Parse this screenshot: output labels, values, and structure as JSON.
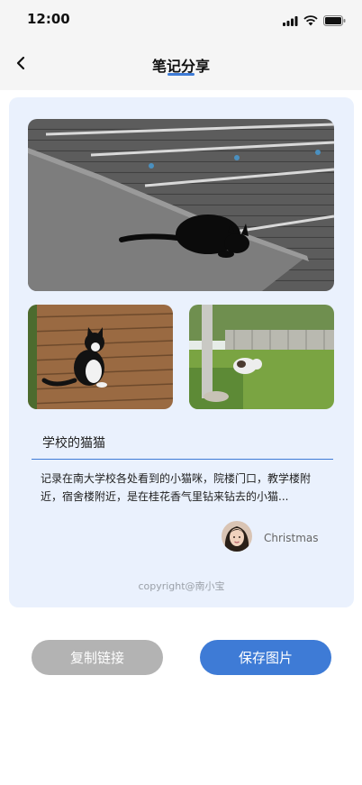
{
  "status": {
    "time": "12:00"
  },
  "nav": {
    "title": "笔记分享"
  },
  "note": {
    "title": "学校的猫猫",
    "body": "记录在南大学校各处看到的小猫咪，院楼门口，教学楼附近，宿舍楼附近，是在桂花香气里钻来钻去的小猫...",
    "author": "Christmas"
  },
  "footer": {
    "copyright": "copyright@南小宝"
  },
  "actions": {
    "copy_label": "复制链接",
    "save_label": "保存图片"
  },
  "colors": {
    "accent": "#3e7bd6",
    "card_bg": "#eaf1fd",
    "disabled_btn": "#b3b3b3"
  },
  "icons": [
    "signal-icon",
    "wifi-icon",
    "battery-icon",
    "back-arrow-icon"
  ]
}
